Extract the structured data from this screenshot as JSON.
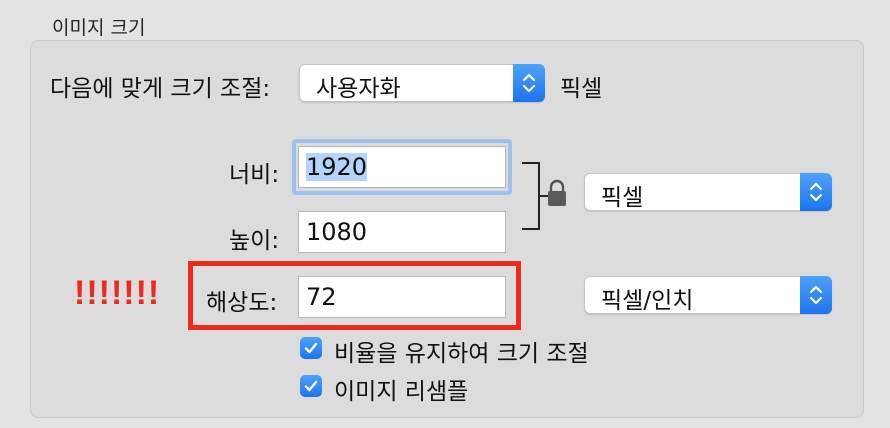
{
  "section_title": "이미지 크기",
  "fit_to": {
    "label": "다음에 맞게 크기 조절:",
    "value": "사용자화",
    "unit": "픽셀"
  },
  "width": {
    "label": "너비:",
    "value": "1920"
  },
  "height": {
    "label": "높이:",
    "value": "1080"
  },
  "dimension_unit": {
    "value": "픽셀"
  },
  "resolution": {
    "label": "해상도:",
    "value": "72",
    "unit": "픽셀/인치"
  },
  "annotation": {
    "text": "!!!!!!!",
    "color": "#ee2a1f"
  },
  "options": {
    "keep_ratio": {
      "label": "비율을 유지하여 크기 조절",
      "checked": true
    },
    "resample": {
      "label": "이미지 리샘플",
      "checked": true
    }
  },
  "colors": {
    "accent": "#1c74ee",
    "highlight": "#ee2a1f"
  },
  "icons": {
    "stepper": "chevron-up-down-icon",
    "lock": "lock-icon",
    "check": "checkmark-icon"
  }
}
